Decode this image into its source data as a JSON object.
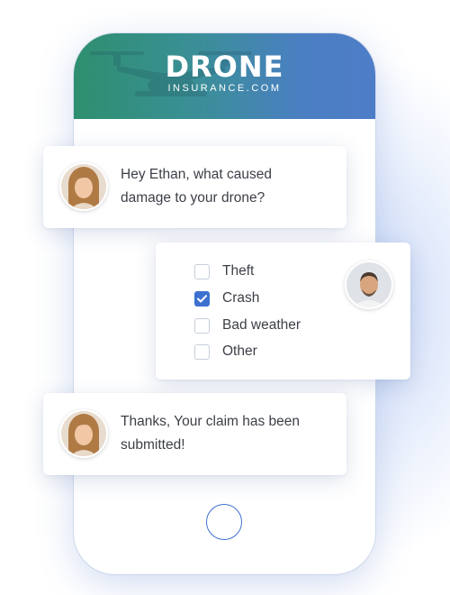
{
  "brand": {
    "name": "DRONE",
    "domain": "INSURANCE.COM",
    "accent_color": "#4f7dc9",
    "check_color": "#3d71cf"
  },
  "chat": {
    "question": {
      "sender": "agent",
      "text": "Hey Ethan, what caused\ndamage to your drone?"
    },
    "reply": {
      "sender": "user",
      "options": [
        {
          "label": "Theft",
          "checked": false
        },
        {
          "label": "Crash",
          "checked": true
        },
        {
          "label": "Bad weather",
          "checked": false
        },
        {
          "label": "Other",
          "checked": false
        }
      ]
    },
    "confirmation": {
      "sender": "agent",
      "text": "Thanks, Your claim has been\nsubmitted!"
    }
  },
  "icons": {
    "agent_avatar": "woman-avatar",
    "user_avatar": "man-avatar",
    "check": "check-icon",
    "home": "home-button"
  }
}
